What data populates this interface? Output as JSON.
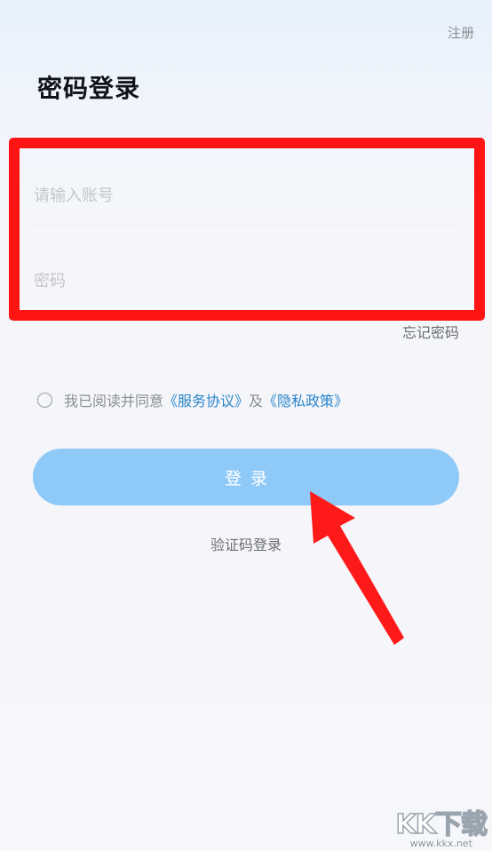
{
  "header": {
    "register_label": "注册",
    "title": "密码登录"
  },
  "form": {
    "account_placeholder": "请输入账号",
    "password_placeholder": "密码",
    "forgot_label": "忘记密码"
  },
  "agreement": {
    "prefix": "我已阅读并同意",
    "service_link": "《服务协议》",
    "conjunction": "及",
    "privacy_link": "《隐私政策》",
    "checked": false
  },
  "actions": {
    "login_label": "登录",
    "sms_login_label": "验证码登录"
  },
  "annotation": {
    "highlight_color": "#ff1414",
    "arrow_color": "#ff1a1a"
  },
  "watermark": {
    "logo_text": "KK下载",
    "url": "www.kkx.net"
  },
  "colors": {
    "primary_button": "#8ec9f7",
    "link": "#2c86c9"
  }
}
